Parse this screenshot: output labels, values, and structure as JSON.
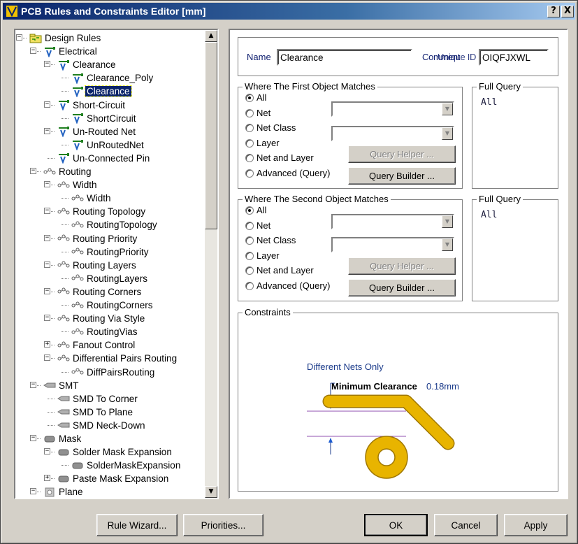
{
  "window": {
    "title": "PCB Rules and Constraints Editor [mm]",
    "help_label": "?",
    "close_label": "X"
  },
  "tree": {
    "items": [
      {
        "label": "Design Rules",
        "level": 0,
        "expander": "-",
        "icon": "folder-icon"
      },
      {
        "label": "Electrical",
        "level": 1,
        "expander": "-",
        "icon": "electrical-rule-icon"
      },
      {
        "label": "Clearance",
        "level": 2,
        "expander": "-",
        "icon": "electrical-rule-icon"
      },
      {
        "label": "Clearance_Poly",
        "level": 3,
        "expander": "",
        "icon": "electrical-rule-icon"
      },
      {
        "label": "Clearance",
        "level": 3,
        "expander": "",
        "icon": "electrical-rule-icon",
        "selected": true
      },
      {
        "label": "Short-Circuit",
        "level": 2,
        "expander": "-",
        "icon": "electrical-rule-icon"
      },
      {
        "label": "ShortCircuit",
        "level": 3,
        "expander": "",
        "icon": "electrical-rule-icon"
      },
      {
        "label": "Un-Routed Net",
        "level": 2,
        "expander": "-",
        "icon": "electrical-rule-icon"
      },
      {
        "label": "UnRoutedNet",
        "level": 3,
        "expander": "",
        "icon": "electrical-rule-icon"
      },
      {
        "label": "Un-Connected Pin",
        "level": 2,
        "expander": "",
        "icon": "electrical-rule-icon"
      },
      {
        "label": "Routing",
        "level": 1,
        "expander": "-",
        "icon": "routing-rule-icon"
      },
      {
        "label": "Width",
        "level": 2,
        "expander": "-",
        "icon": "routing-rule-icon"
      },
      {
        "label": "Width",
        "level": 3,
        "expander": "",
        "icon": "routing-rule-icon"
      },
      {
        "label": "Routing Topology",
        "level": 2,
        "expander": "-",
        "icon": "routing-rule-icon"
      },
      {
        "label": "RoutingTopology",
        "level": 3,
        "expander": "",
        "icon": "routing-rule-icon"
      },
      {
        "label": "Routing Priority",
        "level": 2,
        "expander": "-",
        "icon": "routing-rule-icon"
      },
      {
        "label": "RoutingPriority",
        "level": 3,
        "expander": "",
        "icon": "routing-rule-icon"
      },
      {
        "label": "Routing Layers",
        "level": 2,
        "expander": "-",
        "icon": "routing-rule-icon"
      },
      {
        "label": "RoutingLayers",
        "level": 3,
        "expander": "",
        "icon": "routing-rule-icon"
      },
      {
        "label": "Routing Corners",
        "level": 2,
        "expander": "-",
        "icon": "routing-rule-icon"
      },
      {
        "label": "RoutingCorners",
        "level": 3,
        "expander": "",
        "icon": "routing-rule-icon"
      },
      {
        "label": "Routing Via Style",
        "level": 2,
        "expander": "-",
        "icon": "routing-rule-icon"
      },
      {
        "label": "RoutingVias",
        "level": 3,
        "expander": "",
        "icon": "routing-rule-icon"
      },
      {
        "label": "Fanout Control",
        "level": 2,
        "expander": "+",
        "icon": "routing-rule-icon"
      },
      {
        "label": "Differential Pairs Routing",
        "level": 2,
        "expander": "-",
        "icon": "routing-rule-icon"
      },
      {
        "label": "DiffPairsRouting",
        "level": 3,
        "expander": "",
        "icon": "routing-rule-icon"
      },
      {
        "label": "SMT",
        "level": 1,
        "expander": "-",
        "icon": "smt-rule-icon"
      },
      {
        "label": "SMD To Corner",
        "level": 2,
        "expander": "",
        "icon": "smt-rule-icon"
      },
      {
        "label": "SMD To Plane",
        "level": 2,
        "expander": "",
        "icon": "smt-rule-icon"
      },
      {
        "label": "SMD Neck-Down",
        "level": 2,
        "expander": "",
        "icon": "smt-rule-icon"
      },
      {
        "label": "Mask",
        "level": 1,
        "expander": "-",
        "icon": "mask-rule-icon"
      },
      {
        "label": "Solder Mask Expansion",
        "level": 2,
        "expander": "-",
        "icon": "mask-rule-icon"
      },
      {
        "label": "SolderMaskExpansion",
        "level": 3,
        "expander": "",
        "icon": "mask-rule-icon"
      },
      {
        "label": "Paste Mask Expansion",
        "level": 2,
        "expander": "+",
        "icon": "mask-rule-icon"
      },
      {
        "label": "Plane",
        "level": 1,
        "expander": "-",
        "icon": "plane-rule-icon"
      }
    ]
  },
  "rule": {
    "name_label": "Name",
    "name_value": "Clearance",
    "comment_label": "Comment",
    "uid_label": "Unique ID",
    "uid_value": "OIQFJXWL"
  },
  "first_match": {
    "title": "Where The First Object Matches",
    "options": [
      "All",
      "Net",
      "Net Class",
      "Layer",
      "Net and Layer",
      "Advanced (Query)"
    ],
    "selected": "All",
    "query_helper": "Query Helper ...",
    "query_builder": "Query Builder ..."
  },
  "second_match": {
    "title": "Where The Second Object Matches",
    "options": [
      "All",
      "Net",
      "Net Class",
      "Layer",
      "Net and Layer",
      "Advanced (Query)"
    ],
    "selected": "All",
    "query_helper": "Query Helper ...",
    "query_builder": "Query Builder ..."
  },
  "full_query_1": {
    "title": "Full Query",
    "text": "All"
  },
  "full_query_2": {
    "title": "Full Query",
    "text": "All"
  },
  "constraints": {
    "title": "Constraints",
    "mode": "Different Nets Only",
    "min_clearance_label": "Minimum Clearance",
    "min_clearance_value": "0.18mm",
    "track_color": "#e8b400",
    "pad_color": "#e8b400"
  },
  "footer": {
    "rule_wizard": "Rule Wizard...",
    "priorities": "Priorities...",
    "ok": "OK",
    "cancel": "Cancel",
    "apply": "Apply"
  }
}
